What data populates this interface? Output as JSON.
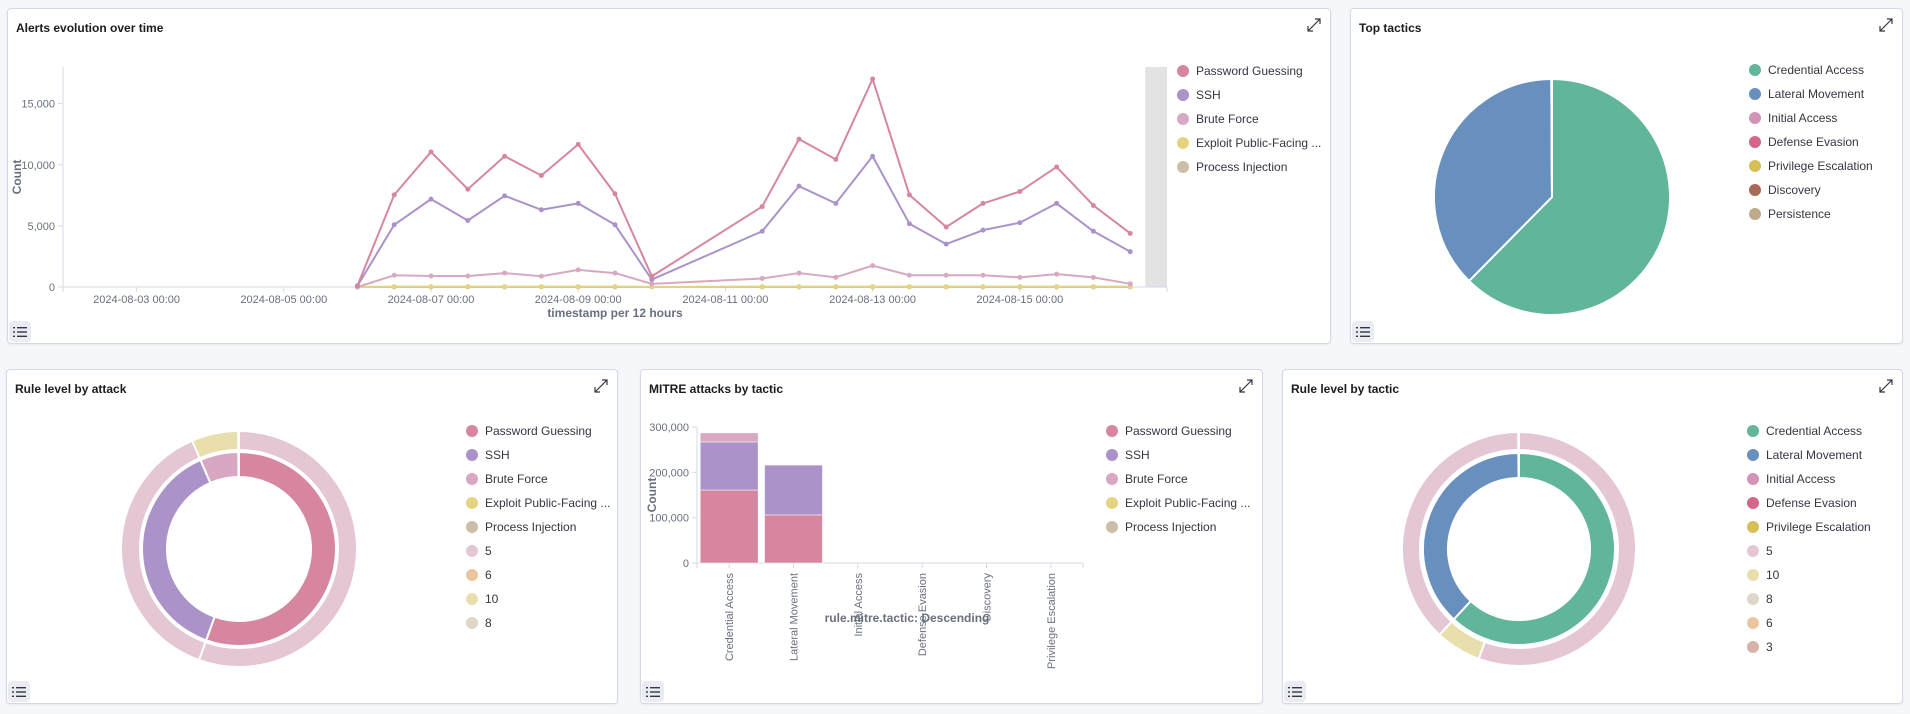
{
  "colors": {
    "Password Guessing": "#d6879f",
    "SSH": "#ab93c9",
    "Brute Force": "#d8a8c2",
    "Exploit Public-Facing Application": "#e4d47e",
    "Process Injection": "#cdbfa7",
    "Credential Access": "#60b59a",
    "Lateral Movement": "#6790bf",
    "Initial Access": "#d194b4",
    "Defense Evasion": "#d3668a",
    "Privilege Escalation": "#d6bf57",
    "Discovery": "#a8685a",
    "Persistence": "#bfaa8c",
    "level_5": "#e4c6d5",
    "level_6": "#ecc59f",
    "level_10": "#e9dfad",
    "level_8": "#ded6c6",
    "level_3": "#d6b3a8"
  },
  "panels": {
    "alerts": {
      "title": "Alerts evolution over time"
    },
    "top_tactics": {
      "title": "Top tactics"
    },
    "rule_by_attack": {
      "title": "Rule level by attack"
    },
    "mitre_by_tactic": {
      "title": "MITRE attacks by tactic"
    },
    "rule_by_tactic": {
      "title": "Rule level by tactic"
    }
  },
  "chart_data": [
    {
      "id": "alerts",
      "type": "line",
      "title": "Alerts evolution over time",
      "xlabel": "timestamp per 12 hours",
      "ylabel": "Count",
      "xlim": [
        "2024-08-02 00:00",
        "2024-08-17 00:00"
      ],
      "ylim": [
        0,
        18000
      ],
      "yticks": [
        0,
        5000,
        10000,
        15000
      ],
      "ytick_labels": [
        "0",
        "5,000",
        "10,000",
        "15,000"
      ],
      "xticks": [
        "2024-08-03 00:00",
        "2024-08-05 00:00",
        "2024-08-07 00:00",
        "2024-08-09 00:00",
        "2024-08-11 00:00",
        "2024-08-13 00:00",
        "2024-08-15 00:00"
      ],
      "partial_bucket_shaded": true,
      "legend_position": "right",
      "legend": [
        "Password Guessing",
        "SSH",
        "Brute Force",
        "Exploit Public-Facing ...",
        "Process Injection"
      ],
      "x": [
        "2024-08-06 00:00",
        "2024-08-06 12:00",
        "2024-08-07 00:00",
        "2024-08-07 12:00",
        "2024-08-08 00:00",
        "2024-08-08 12:00",
        "2024-08-09 00:00",
        "2024-08-09 12:00",
        "2024-08-10 00:00",
        "2024-08-11 12:00",
        "2024-08-12 00:00",
        "2024-08-12 12:00",
        "2024-08-13 00:00",
        "2024-08-13 12:00",
        "2024-08-14 00:00",
        "2024-08-14 12:00",
        "2024-08-15 00:00",
        "2024-08-15 12:00",
        "2024-08-16 00:00",
        "2024-08-16 12:00"
      ],
      "series": [
        {
          "name": "Password Guessing",
          "values": [
            100,
            7540,
            11050,
            8000,
            10700,
            9120,
            11670,
            7630,
            880,
            6580,
            12100,
            10440,
            17020,
            7540,
            4910,
            6840,
            7810,
            9820,
            6670,
            4390
          ]
        },
        {
          "name": "SSH",
          "values": [
            80,
            5090,
            7190,
            5440,
            7460,
            6320,
            6840,
            5090,
            610,
            4560,
            8250,
            6840,
            10700,
            5180,
            3510,
            4650,
            5260,
            6840,
            4560,
            2890
          ]
        },
        {
          "name": "Brute Force",
          "values": [
            0,
            960,
            900,
            900,
            1140,
            880,
            1400,
            1140,
            260,
            700,
            1140,
            790,
            1750,
            960,
            960,
            960,
            790,
            1050,
            790,
            260
          ]
        },
        {
          "name": "Exploit Public-Facing Application",
          "values": [
            0,
            30,
            30,
            30,
            30,
            30,
            30,
            30,
            10,
            30,
            30,
            30,
            30,
            30,
            30,
            30,
            30,
            30,
            30,
            30
          ]
        },
        {
          "name": "Process Injection",
          "values": [
            0,
            5,
            5,
            5,
            5,
            5,
            5,
            5,
            0,
            5,
            5,
            5,
            5,
            5,
            5,
            5,
            5,
            5,
            5,
            5
          ]
        }
      ]
    },
    {
      "id": "top_tactics",
      "type": "pie",
      "title": "Top tactics",
      "legend_position": "right",
      "legend": [
        "Credential Access",
        "Lateral Movement",
        "Initial Access",
        "Defense Evasion",
        "Privilege Escalation",
        "Discovery",
        "Persistence"
      ],
      "slices": [
        {
          "label": "Credential Access",
          "value": 62.4
        },
        {
          "label": "Lateral Movement",
          "value": 37.5
        },
        {
          "label": "Initial Access",
          "value": 0.03
        },
        {
          "label": "Defense Evasion",
          "value": 0.02
        },
        {
          "label": "Privilege Escalation",
          "value": 0.02
        },
        {
          "label": "Discovery",
          "value": 0.01
        },
        {
          "label": "Persistence",
          "value": 0.01
        }
      ]
    },
    {
      "id": "rule_by_attack",
      "type": "pie",
      "subtype": "nested-donut",
      "title": "Rule level by attack",
      "legend_position": "right",
      "legend": [
        "Password Guessing",
        "SSH",
        "Brute Force",
        "Exploit Public-Facing ...",
        "Process Injection",
        "5",
        "6",
        "10",
        "8"
      ],
      "inner": [
        {
          "label": "Password Guessing",
          "value": 55.5
        },
        {
          "label": "SSH",
          "value": 38.0
        },
        {
          "label": "Brute Force",
          "value": 6.4
        },
        {
          "label": "Exploit Public-Facing Application",
          "value": 0.05
        },
        {
          "label": "Process Injection",
          "value": 0.05
        }
      ],
      "outer": [
        {
          "parent": "Password Guessing",
          "label": "5",
          "value": 55.5
        },
        {
          "parent": "SSH",
          "label": "5",
          "value": 38.0
        },
        {
          "parent": "Brute Force",
          "label": "10",
          "value": 6.4
        },
        {
          "parent": "Exploit Public-Facing Application",
          "label": "6",
          "value": 0.05
        },
        {
          "parent": "Process Injection",
          "label": "8",
          "value": 0.05
        }
      ]
    },
    {
      "id": "mitre_by_tactic",
      "type": "bar",
      "stacked": true,
      "title": "MITRE attacks by tactic",
      "xlabel": "rule.mitre.tactic: Descending",
      "ylabel": "Count",
      "ylim": [
        0,
        300000
      ],
      "yticks": [
        0,
        100000,
        200000,
        300000
      ],
      "ytick_labels": [
        "0",
        "100,000",
        "200,000",
        "300,000"
      ],
      "legend_position": "right",
      "legend": [
        "Password Guessing",
        "SSH",
        "Brute Force",
        "Exploit Public-Facing ...",
        "Process Injection"
      ],
      "categories": [
        "Credential Access",
        "Lateral Movement",
        "Initial Access",
        "Defense Evasion",
        "Discovery",
        "Privilege Escalation"
      ],
      "series": [
        {
          "name": "Password Guessing",
          "values": [
            161000,
            106000,
            0,
            0,
            0,
            0
          ]
        },
        {
          "name": "SSH",
          "values": [
            106000,
            110000,
            0,
            0,
            0,
            0
          ]
        },
        {
          "name": "Brute Force",
          "values": [
            20000,
            0,
            0,
            0,
            0,
            0
          ]
        },
        {
          "name": "Exploit Public-Facing Application",
          "values": [
            0,
            0,
            150,
            0,
            0,
            0
          ]
        },
        {
          "name": "Process Injection",
          "values": [
            0,
            0,
            0,
            40,
            20,
            20
          ]
        }
      ]
    },
    {
      "id": "rule_by_tactic",
      "type": "pie",
      "subtype": "nested-donut",
      "title": "Rule level by tactic",
      "legend_position": "right",
      "legend": [
        "Credential Access",
        "Lateral Movement",
        "Initial Access",
        "Defense Evasion",
        "Privilege Escalation",
        "5",
        "10",
        "8",
        "6",
        "3"
      ],
      "inner": [
        {
          "label": "Credential Access",
          "value": 61.9
        },
        {
          "label": "Lateral Movement",
          "value": 38.0
        },
        {
          "label": "Initial Access",
          "value": 0.04
        },
        {
          "label": "Defense Evasion",
          "value": 0.03
        },
        {
          "label": "Privilege Escalation",
          "value": 0.03
        }
      ],
      "outer": [
        {
          "parent": "Credential Access",
          "label": "5",
          "value": 55.6
        },
        {
          "parent": "Credential Access",
          "label": "10",
          "value": 6.3
        },
        {
          "parent": "Lateral Movement",
          "label": "5",
          "value": 38.0
        },
        {
          "parent": "Initial Access",
          "label": "6",
          "value": 0.04
        },
        {
          "parent": "Defense Evasion",
          "label": "8",
          "value": 0.03
        },
        {
          "parent": "Privilege Escalation",
          "label": "3",
          "value": 0.03
        }
      ]
    }
  ]
}
